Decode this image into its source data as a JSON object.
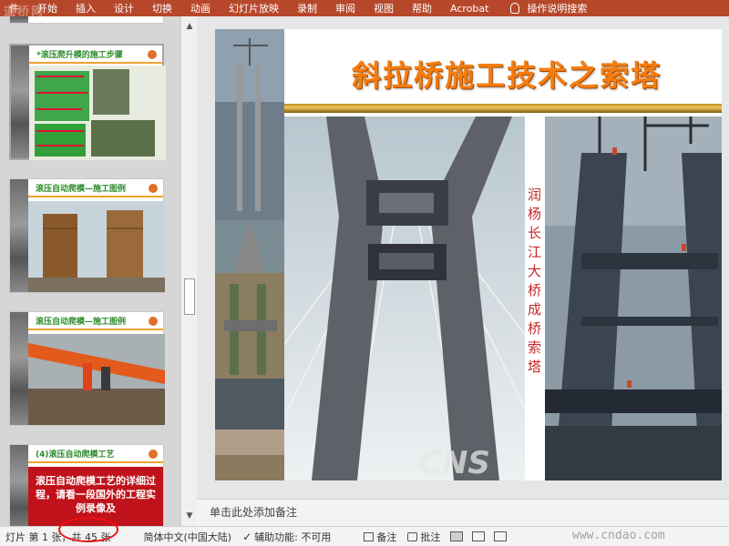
{
  "ribbon": {
    "tabs": [
      "件",
      "开始",
      "插入",
      "设计",
      "切换",
      "动画",
      "幻灯片放映",
      "录制",
      "审阅",
      "视图",
      "帮助",
      "Acrobat"
    ],
    "search_label": "操作说明搜索"
  },
  "top_watermark": "道桥网",
  "thumbnails": [
    {
      "title": "*滚压爬升模的施工步骤",
      "selected": true
    },
    {
      "title": "滚压自动爬模—施工图例",
      "selected": false
    },
    {
      "title": "滚压自动爬模—施工图例",
      "selected": false
    },
    {
      "title": "(4)滚压自动爬模工艺",
      "selected": false,
      "body_text": "滚压自动爬模工艺的详细过程，请看一段国外的工程实例录像及"
    }
  ],
  "slide": {
    "title": "斜拉桥施工技术之索塔",
    "side_caption": "润杨长江大桥成桥索塔",
    "photo_watermark": "CNS"
  },
  "notes_placeholder": "单击此处添加备注",
  "status_bar": {
    "slide_info": "灯片 第 1 张，共 45 张",
    "language": "简体中文(中国大陆)",
    "accessibility": "辅助功能: 不可用",
    "notes_button": "备注",
    "comments_button": "批注",
    "site_watermark": "www.cndao.com"
  },
  "colors": {
    "ribbon": "#b7472a",
    "title_orange": "#f37e10",
    "caption_red": "#c62727",
    "thumb_title_green": "#2e8b2e"
  }
}
